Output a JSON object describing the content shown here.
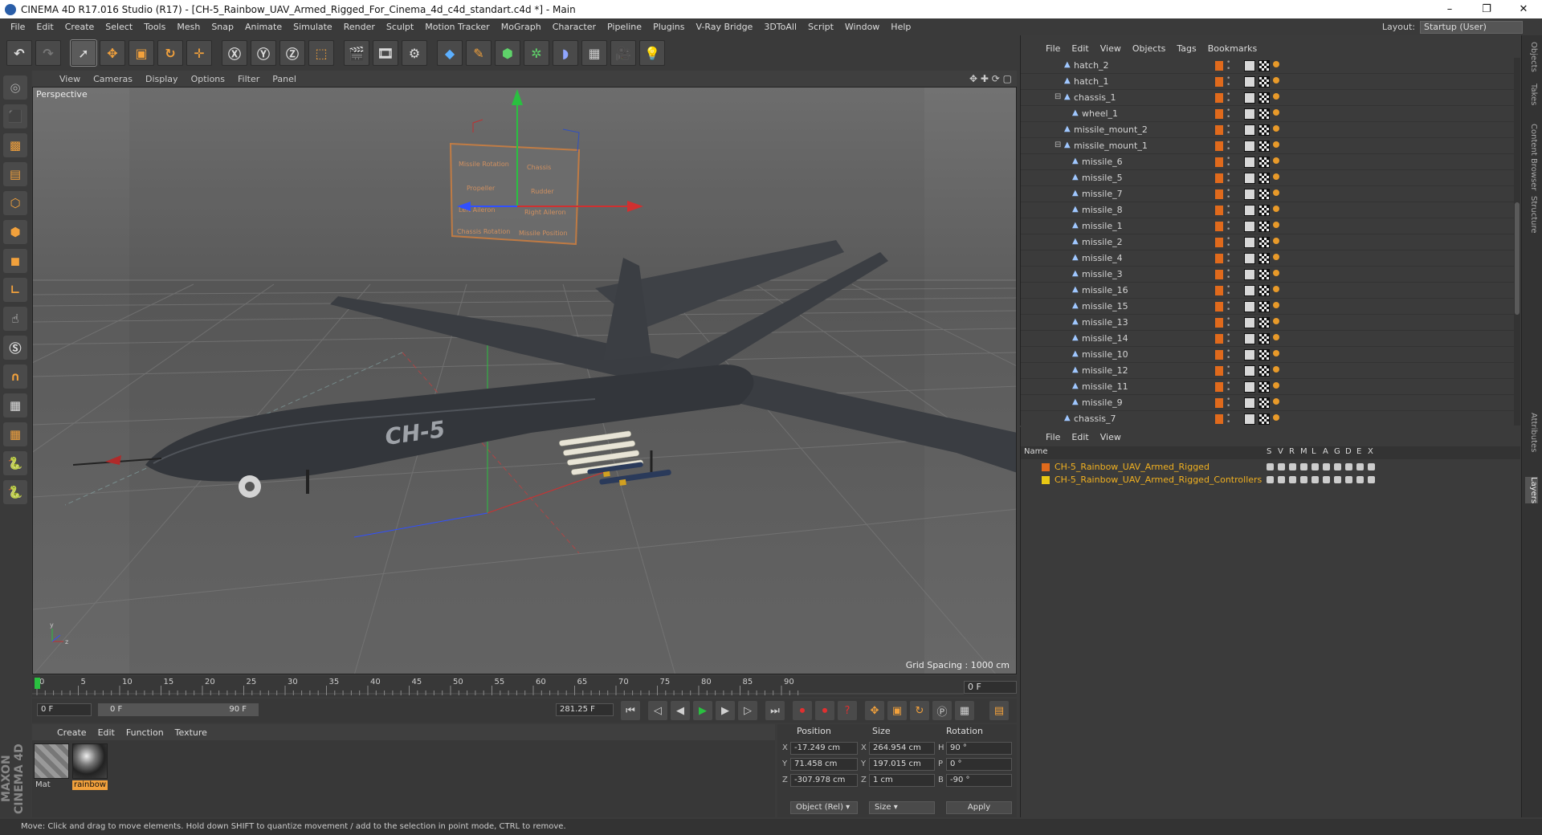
{
  "window": {
    "title": "CINEMA 4D R17.016 Studio (R17) - [CH-5_Rainbow_UAV_Armed_Rigged_For_Cinema_4d_c4d_standart.c4d *] - Main"
  },
  "menu": [
    "File",
    "Edit",
    "Create",
    "Select",
    "Tools",
    "Mesh",
    "Snap",
    "Animate",
    "Simulate",
    "Render",
    "Sculpt",
    "Motion Tracker",
    "MoGraph",
    "Character",
    "Pipeline",
    "Plugins",
    "V-Ray Bridge",
    "3DToAll",
    "Script",
    "Window",
    "Help"
  ],
  "layout": {
    "label": "Layout:",
    "value": "Startup (User)"
  },
  "viewport": {
    "menu": [
      "View",
      "Cameras",
      "Display",
      "Options",
      "Filter",
      "Panel"
    ],
    "camera_label": "Perspective",
    "grid_spacing": "Grid Spacing : 1000 cm",
    "model_text": "CH-5",
    "controller_labels": [
      "Missile Rotation",
      "Chassis",
      "Propeller",
      "Rudder",
      "Left Aileron",
      "Right Aileron",
      "Chassis Rotation",
      "Missile Position"
    ]
  },
  "timeline": {
    "ticks": [
      "0",
      "5",
      "10",
      "15",
      "20",
      "25",
      "30",
      "35",
      "40",
      "45",
      "50",
      "55",
      "60",
      "65",
      "70",
      "75",
      "80",
      "85",
      "90"
    ],
    "current_frame": "0 F",
    "start_field": "0 F",
    "range_start": "0 F",
    "range_end": "90 F",
    "fps_field": "281.25 F"
  },
  "material_manager": {
    "menu": [
      "Create",
      "Edit",
      "Function",
      "Texture"
    ],
    "materials": [
      {
        "name": "Mat"
      },
      {
        "name": "rainbow"
      }
    ]
  },
  "coordinates": {
    "headers": {
      "position": "Position",
      "size": "Size",
      "rotation": "Rotation"
    },
    "rows": [
      {
        "axis": "X",
        "pos": "-17.249 cm",
        "size_axis": "X",
        "size": "264.954 cm",
        "rot_axis": "H",
        "rot": "90 °"
      },
      {
        "axis": "Y",
        "pos": "71.458 cm",
        "size_axis": "Y",
        "size": "197.015 cm",
        "rot_axis": "P",
        "rot": "0 °"
      },
      {
        "axis": "Z",
        "pos": "-307.978 cm",
        "size_axis": "Z",
        "size": "1 cm",
        "rot_axis": "B",
        "rot": "-90 °"
      }
    ],
    "mode": "Object (Rel)",
    "size_mode": "Size",
    "apply": "Apply"
  },
  "object_manager": {
    "menu": [
      "File",
      "Edit",
      "View",
      "Objects",
      "Tags",
      "Bookmarks"
    ],
    "rows": [
      {
        "name": "hatch_2",
        "depth": 1,
        "exp": ""
      },
      {
        "name": "hatch_1",
        "depth": 1,
        "exp": ""
      },
      {
        "name": "chassis_1",
        "depth": 1,
        "exp": "−"
      },
      {
        "name": "wheel_1",
        "depth": 2,
        "exp": ""
      },
      {
        "name": "missile_mount_2",
        "depth": 1,
        "exp": ""
      },
      {
        "name": "missile_mount_1",
        "depth": 1,
        "exp": "−"
      },
      {
        "name": "missile_6",
        "depth": 2,
        "exp": ""
      },
      {
        "name": "missile_5",
        "depth": 2,
        "exp": ""
      },
      {
        "name": "missile_7",
        "depth": 2,
        "exp": ""
      },
      {
        "name": "missile_8",
        "depth": 2,
        "exp": ""
      },
      {
        "name": "missile_1",
        "depth": 2,
        "exp": ""
      },
      {
        "name": "missile_2",
        "depth": 2,
        "exp": ""
      },
      {
        "name": "missile_4",
        "depth": 2,
        "exp": ""
      },
      {
        "name": "missile_3",
        "depth": 2,
        "exp": ""
      },
      {
        "name": "missile_16",
        "depth": 2,
        "exp": ""
      },
      {
        "name": "missile_15",
        "depth": 2,
        "exp": ""
      },
      {
        "name": "missile_13",
        "depth": 2,
        "exp": ""
      },
      {
        "name": "missile_14",
        "depth": 2,
        "exp": ""
      },
      {
        "name": "missile_10",
        "depth": 2,
        "exp": ""
      },
      {
        "name": "missile_12",
        "depth": 2,
        "exp": ""
      },
      {
        "name": "missile_11",
        "depth": 2,
        "exp": ""
      },
      {
        "name": "missile_9",
        "depth": 2,
        "exp": ""
      },
      {
        "name": "chassis_7",
        "depth": 1,
        "exp": ""
      }
    ]
  },
  "layer_manager": {
    "menu": [
      "File",
      "Edit",
      "View"
    ],
    "columns": [
      "Name",
      "S",
      "V",
      "R",
      "M",
      "L",
      "A",
      "G",
      "D",
      "E",
      "X"
    ],
    "layers": [
      {
        "name": "CH-5_Rainbow_UAV_Armed_Rigged",
        "color": "#e06a1c"
      },
      {
        "name": "CH-5_Rainbow_UAV_Armed_Rigged_Controllers",
        "color": "#e8c814"
      }
    ]
  },
  "right_tabs": [
    "Objects",
    "Takes",
    "Content Browser",
    "Structure",
    "Attributes",
    "Layers"
  ],
  "maxon_logo": "MAXON CINEMA 4D",
  "status": "Move: Click and drag to move elements. Hold down SHIFT to quantize movement / add to the selection in point mode, CTRL to remove.",
  "colors": {
    "accent": "#f2a13c",
    "layer_text": "#f0b020"
  }
}
